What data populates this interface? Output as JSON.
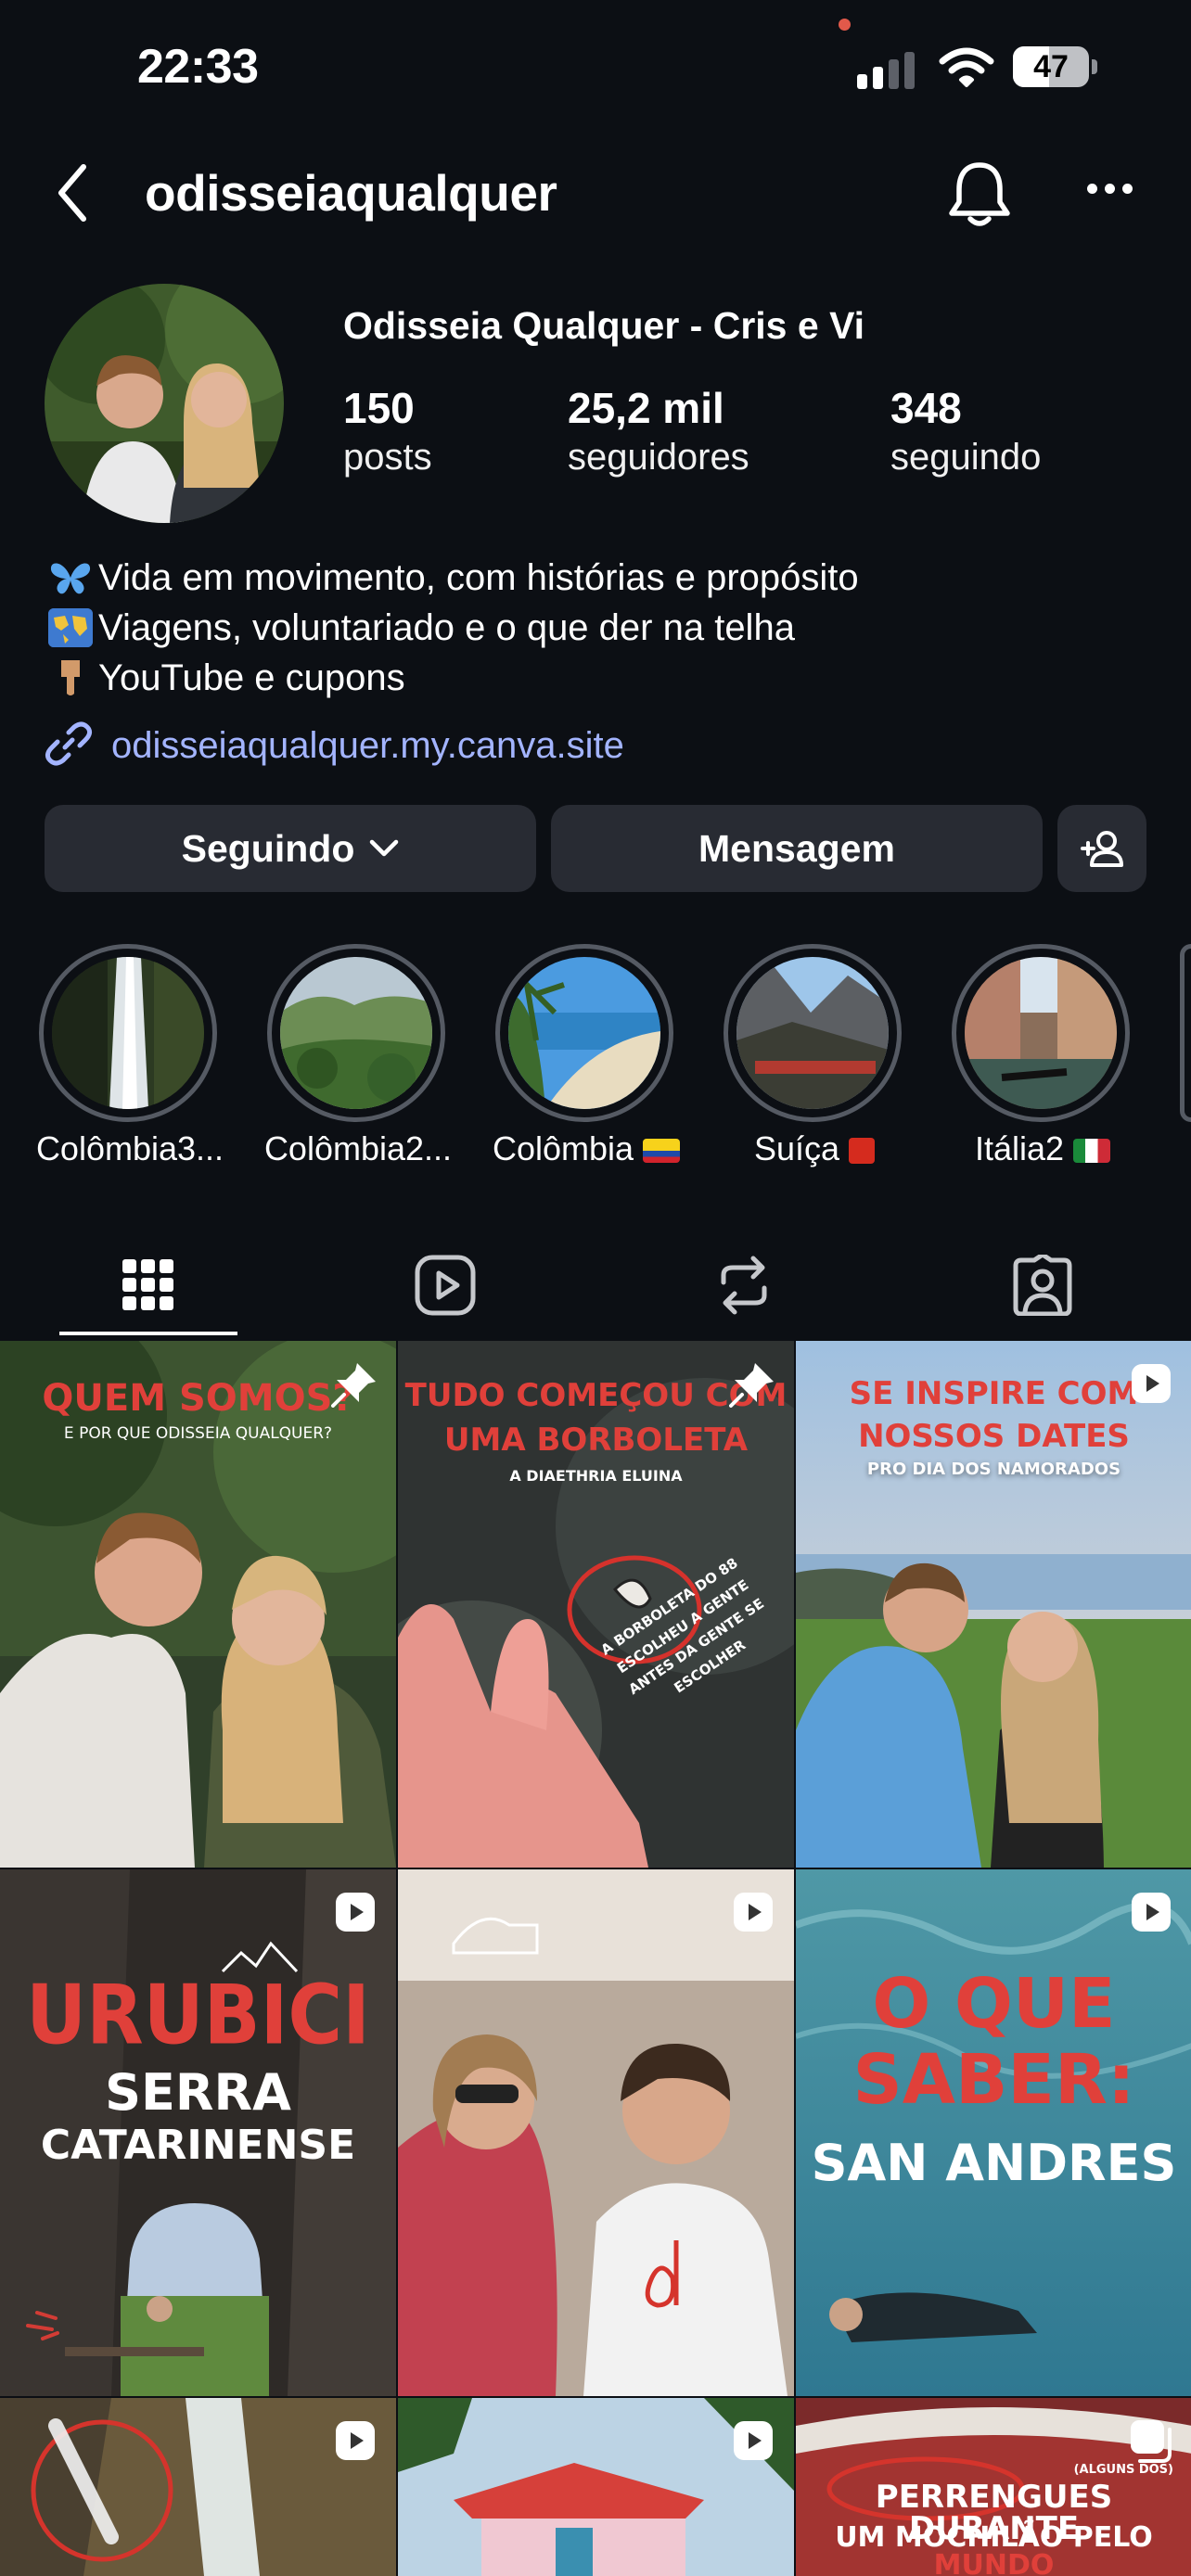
{
  "status_bar": {
    "time": "22:33",
    "battery": "47",
    "battery_level": 0.47
  },
  "header": {
    "username": "odisseiaqualquer"
  },
  "profile": {
    "display_name": "Odisseia Qualquer - Cris e Vi",
    "stats": [
      {
        "value": "150",
        "label": "posts"
      },
      {
        "value": "25,2 mil",
        "label": "seguidores"
      },
      {
        "value": "348",
        "label": "seguindo"
      }
    ],
    "bio": [
      {
        "emoji": "butterfly",
        "text": "Vida em movimento, com histórias e propósito"
      },
      {
        "emoji": "world-map",
        "text": "Viagens, voluntariado e o que der na telha"
      },
      {
        "emoji": "pointing-down-hand",
        "text": "YouTube e cupons"
      }
    ],
    "link": "odisseiaqualquer.my.canva.site"
  },
  "actions": {
    "follow": "Seguindo",
    "message": "Mensagem"
  },
  "highlights": [
    {
      "label": "Colômbia3...",
      "flag": ""
    },
    {
      "label": "Colômbia2...",
      "flag": ""
    },
    {
      "label": "Colômbia",
      "flag": "colombia"
    },
    {
      "label": "Suíça",
      "flag": "switzerland"
    },
    {
      "label": "Itália2",
      "flag": "italy"
    }
  ],
  "tabs": [
    "grid",
    "reels",
    "reposts",
    "tagged"
  ],
  "posts": [
    {
      "type": "pinned",
      "title": "QUEM SOMOS?",
      "subtitle": "E POR QUE ODISSEIA QUALQUER?"
    },
    {
      "type": "pinned",
      "title_1": "TUDO COMEÇOU COM",
      "title_2": "UMA BORBOLETA",
      "subtitle": "A DIAETHRIA ELUINA",
      "note_1": "A BORBOLETA DO 88",
      "note_2": "ESCOLHEU A GENTE",
      "note_3": "ANTES DA GENTE SE ESCOLHER"
    },
    {
      "type": "reel",
      "title_1": "SE INSPIRE COM",
      "title_2": "NOSSOS DATES",
      "subtitle": "PRO DIA DOS NAMORADOS"
    },
    {
      "type": "reel",
      "title_1": "URUBICI",
      "title_2": "SERRA",
      "title_3": "CATARINENSE"
    },
    {
      "type": "reel"
    },
    {
      "type": "reel",
      "title_1": "O QUE",
      "title_2": "SABER:",
      "title_3": "SAN ANDRES"
    },
    {
      "type": "reel"
    },
    {
      "type": "reel"
    },
    {
      "type": "carousel",
      "kicker": "(ALGUNS DOS)",
      "title_1": "PERRENGUES DURANTE",
      "title_2a": "UM MOCHILÃO PELO",
      "title_2b": "MUNDO"
    }
  ],
  "colors": {
    "background": "#0c0f14",
    "button": "#282b33",
    "link": "#a3b4ff",
    "accent_red": "#e0403a"
  }
}
